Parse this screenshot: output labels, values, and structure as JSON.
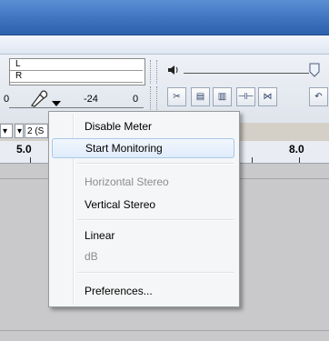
{
  "meter": {
    "left_label": "L",
    "right_label": "R",
    "scale_zero_left": "0",
    "scale_minus24": "-24",
    "scale_zero_right": "0"
  },
  "toolbar": {
    "mic_icon": "microphone-icon",
    "dropdown_icon": "chevron-down-icon",
    "speaker_icon": "speaker-icon",
    "channels_value": "2 (S"
  },
  "ruler": {
    "left_mark": "5.0",
    "right_mark": "8.0"
  },
  "context_menu": {
    "items": [
      {
        "label": "Disable Meter",
        "enabled": true
      },
      {
        "label": "Start Monitoring",
        "enabled": true,
        "highlighted": true
      },
      {
        "label": "Horizontal Stereo",
        "enabled": false
      },
      {
        "label": "Vertical Stereo",
        "enabled": true
      },
      {
        "label": "Linear",
        "enabled": true
      },
      {
        "label": "dB",
        "enabled": false
      },
      {
        "label": "Preferences...",
        "enabled": true
      }
    ]
  }
}
